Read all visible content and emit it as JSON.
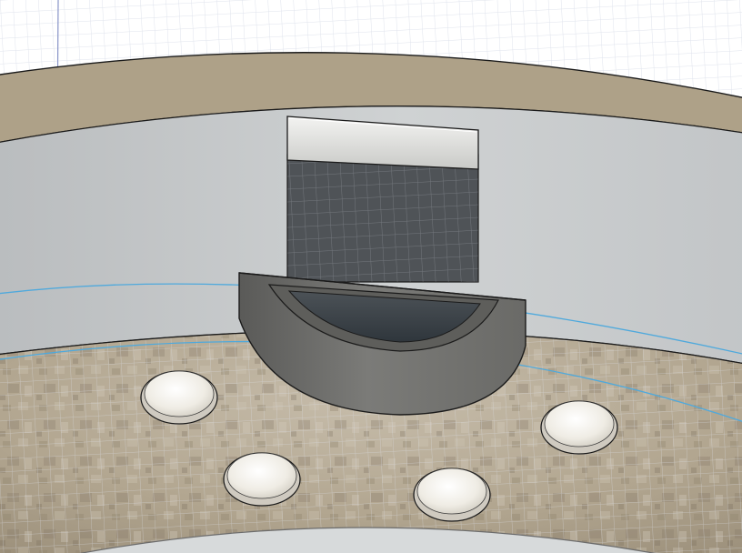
{
  "viewport": {
    "view_type": "3D model viewport",
    "colors": {
      "background": "#ffffff",
      "grid_minor": "#dfe3ec",
      "grid_major": "#b7c0d8",
      "rim_top": "#aea188",
      "inner_wall": "#c5c8ca",
      "floor": "#b5a994",
      "clip_body": "#6b6b68",
      "clip_slot": "#3f4850",
      "tab": "#dedfdd",
      "highlight_line": "#4fa9dc",
      "foot": "#f1efea",
      "edge": "#1b1b1b"
    }
  },
  "model": {
    "parts": [
      {
        "name": "outer-rim-top-face",
        "icon": "arc-surface"
      },
      {
        "name": "inner-wall",
        "icon": "cylindrical-surface"
      },
      {
        "name": "textured-floor",
        "icon": "plane-surface"
      },
      {
        "name": "clip-holder",
        "icon": "half-cylinder-bracket"
      },
      {
        "name": "slot-tab",
        "icon": "rectangular-tab"
      },
      {
        "name": "rubber-foot",
        "count": 4,
        "icon": "dome"
      }
    ]
  }
}
